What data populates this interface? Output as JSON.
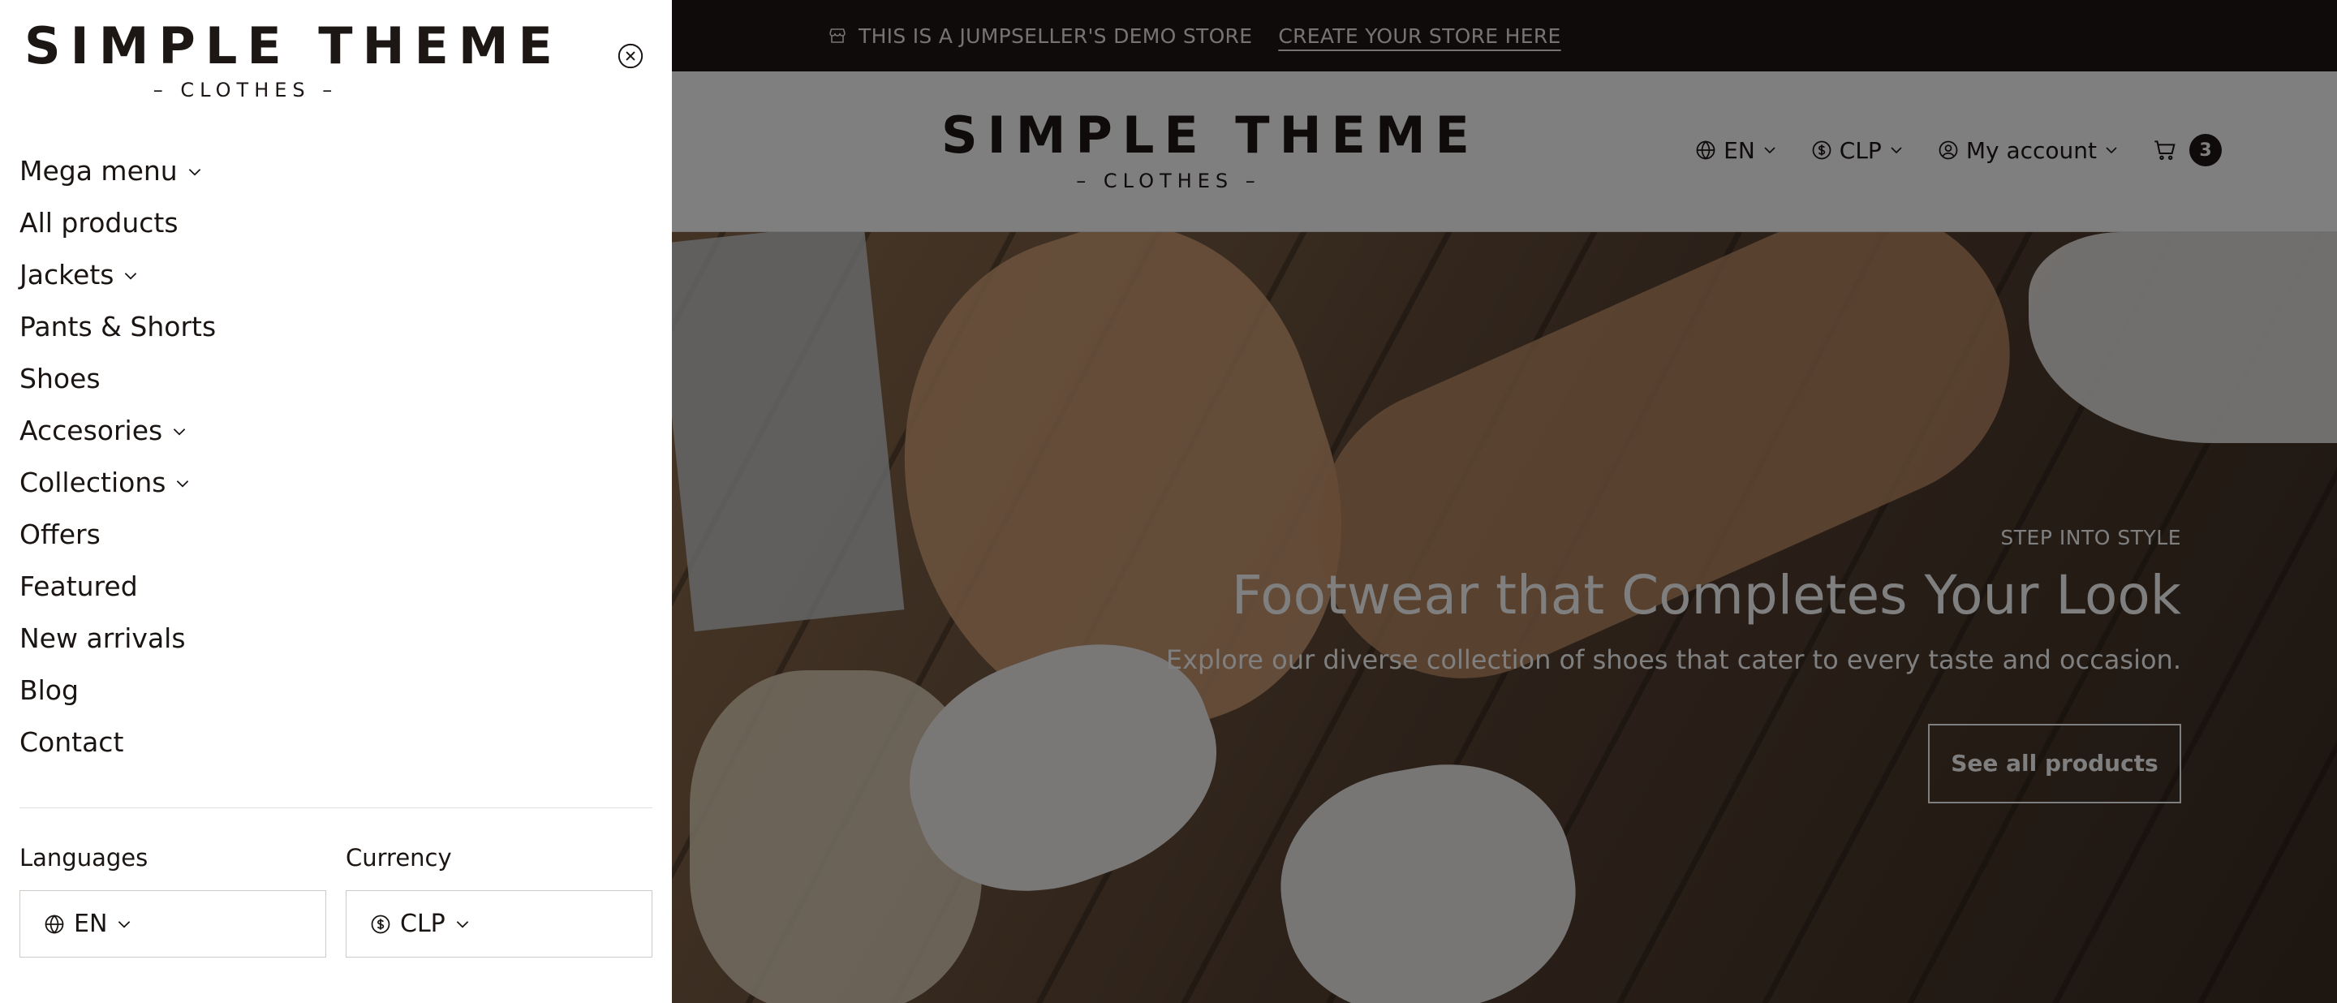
{
  "announcement": {
    "text": "THIS IS A JUMPSELLER'S DEMO STORE",
    "link": "CREATE YOUR STORE HERE",
    "icon": "store-icon"
  },
  "brand": {
    "title": "SIMPLE THEME",
    "subtitle": "– CLOTHES –"
  },
  "header": {
    "language": "EN",
    "currency": "CLP",
    "account": "My account",
    "cart_count": "3"
  },
  "hero": {
    "kicker": "STEP INTO STYLE",
    "title": "Footwear that Completes Your Look",
    "subtitle": "Explore our diverse collection of shoes that cater to every taste and occasion.",
    "button": "See all products"
  },
  "drawer": {
    "menu": [
      {
        "label": "Mega menu",
        "has_children": true
      },
      {
        "label": "All products",
        "has_children": false
      },
      {
        "label": "Jackets",
        "has_children": true
      },
      {
        "label": "Pants & Shorts",
        "has_children": false
      },
      {
        "label": "Shoes",
        "has_children": false
      },
      {
        "label": "Accesories",
        "has_children": true
      },
      {
        "label": "Collections",
        "has_children": true
      },
      {
        "label": "Offers",
        "has_children": false
      },
      {
        "label": "Featured",
        "has_children": false
      },
      {
        "label": "New arrivals",
        "has_children": false
      },
      {
        "label": "Blog",
        "has_children": false
      },
      {
        "label": "Contact",
        "has_children": false
      }
    ],
    "languages_label": "Languages",
    "currency_label": "Currency",
    "language_value": "EN",
    "currency_value": "CLP"
  },
  "colors": {
    "topbar_bg": "#1c1614",
    "text_dark": "#1a1512",
    "overlay": "rgba(0,0,0,0.5)"
  }
}
